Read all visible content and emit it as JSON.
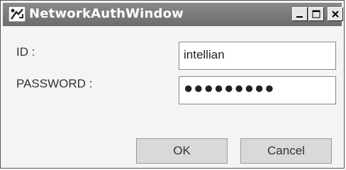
{
  "window": {
    "title": "NetworkAuthWindow",
    "icon": "network-app-icon",
    "controls": {
      "minimize": "minimize-icon",
      "maximize": "maximize-icon",
      "close": "close-icon"
    }
  },
  "form": {
    "id_label": "ID :",
    "id_value": "intellian",
    "password_label": "PASSWORD :",
    "password_value": "●●●●●●●●●"
  },
  "buttons": {
    "ok_label": "OK",
    "cancel_label": "Cancel"
  }
}
